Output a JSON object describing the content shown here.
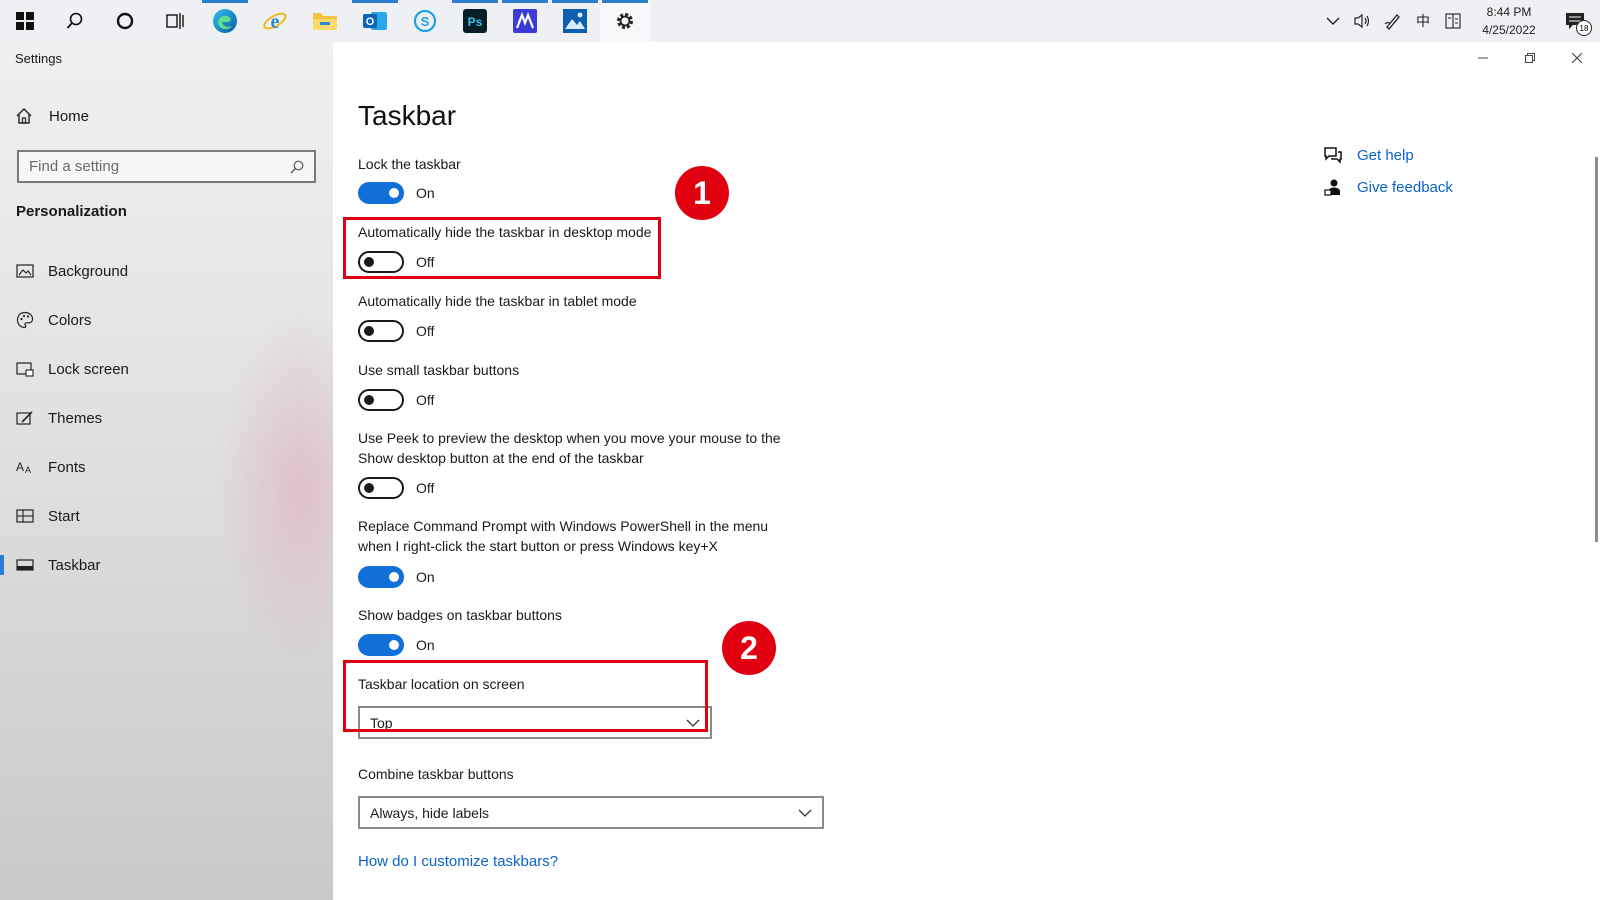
{
  "taskbar": {
    "apps": [
      {
        "name": "windows-start",
        "glyph": "start"
      },
      {
        "name": "search",
        "glyph": "search"
      },
      {
        "name": "cortana",
        "glyph": "circle"
      },
      {
        "name": "task-view",
        "glyph": "taskview"
      },
      {
        "name": "edge",
        "glyph": "edge"
      },
      {
        "name": "internet-explorer",
        "glyph": "ie"
      },
      {
        "name": "file-explorer",
        "glyph": "folder"
      },
      {
        "name": "outlook",
        "glyph": "outlook"
      },
      {
        "name": "skype",
        "glyph": "skype"
      },
      {
        "name": "photoshop",
        "glyph": "ps"
      },
      {
        "name": "app-m",
        "glyph": "m"
      },
      {
        "name": "photos",
        "glyph": "photos"
      },
      {
        "name": "settings",
        "glyph": "gear"
      }
    ],
    "tray": {
      "ime_label": "中",
      "time": "8:44 PM",
      "date": "4/25/2022",
      "notification_count": "18"
    }
  },
  "nav": {
    "app_title": "Settings",
    "home_label": "Home",
    "search_placeholder": "Find a setting",
    "section": "Personalization",
    "items": [
      {
        "label": "Background",
        "icon": "picture-icon"
      },
      {
        "label": "Colors",
        "icon": "palette-icon"
      },
      {
        "label": "Lock screen",
        "icon": "lock-screen-icon"
      },
      {
        "label": "Themes",
        "icon": "themes-icon"
      },
      {
        "label": "Fonts",
        "icon": "fonts-icon"
      },
      {
        "label": "Start",
        "icon": "start-icon"
      },
      {
        "label": "Taskbar",
        "icon": "taskbar-icon"
      }
    ]
  },
  "main": {
    "title": "Taskbar",
    "settings": [
      {
        "label": "Lock the taskbar",
        "state": "On"
      },
      {
        "label": "Automatically hide the taskbar in desktop mode",
        "state": "Off"
      },
      {
        "label": "Automatically hide the taskbar in tablet mode",
        "state": "Off"
      },
      {
        "label": "Use small taskbar buttons",
        "state": "Off"
      },
      {
        "label_line1": "Use Peek to preview the desktop when you move your mouse to the",
        "label_line2": "Show desktop button at the end of the taskbar",
        "state": "Off"
      },
      {
        "label_line1": "Replace Command Prompt with Windows PowerShell in the menu",
        "label_line2": "when I right-click the start button or press Windows key+X",
        "state": "On"
      },
      {
        "label": "Show badges on taskbar buttons",
        "state": "On"
      }
    ],
    "location": {
      "label": "Taskbar location on screen",
      "value": "Top"
    },
    "combine": {
      "label": "Combine taskbar buttons",
      "value": "Always, hide labels"
    },
    "customize_link": "How do I customize taskbars?",
    "get_help": "Get help",
    "give_feedback": "Give feedback",
    "annotations": {
      "first": "1",
      "second": "2"
    },
    "accent_color": "#1070d8",
    "annotation_color": "#e00010"
  }
}
